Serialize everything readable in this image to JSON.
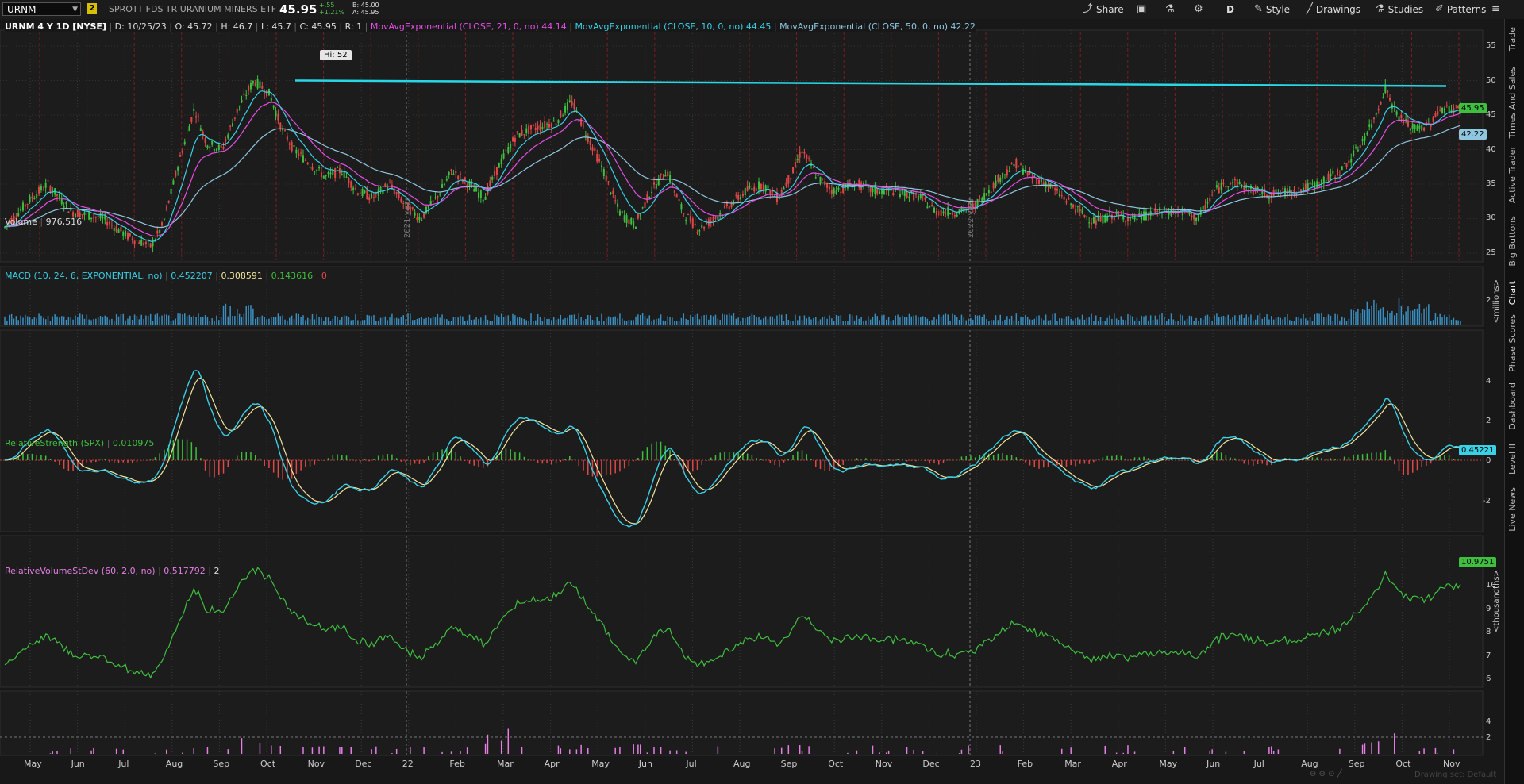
{
  "header": {
    "symbol": "URNM",
    "link_badge": "2",
    "description": "SPROTT FDS TR URANIUM MINERS ETF",
    "last": "45.95",
    "change": "+.55",
    "change_pct": "+1.21%",
    "bid": "B: 45.00",
    "ask": "A: 45.95"
  },
  "toolbar": {
    "share": "Share",
    "timeframe": "D",
    "style": "Style",
    "drawings": "Drawings",
    "studies": "Studies",
    "patterns": "Patterns"
  },
  "price_panel": {
    "title": "URNM 4 Y 1D [NYSE]",
    "ohlc": {
      "date": "D: 10/25/23",
      "open": "O: 45.72",
      "high": "H: 46.7",
      "low": "L: 45.7",
      "close": "C: 45.95",
      "r": "R: 1"
    },
    "ema21_label": "MovAvgExponential (CLOSE, 21, 0, no)",
    "ema21_value": "44.14",
    "ema10_label": "MovAvgExponential (CLOSE, 10, 0, no)",
    "ema10_value": "44.45",
    "ema50_label": "MovAvgExponential (CLOSE, 50, 0, no)",
    "ema50_value": "42.22",
    "hi_label": "Hi: 52",
    "price_tag": "45.95",
    "ema_tag": "42.22",
    "axis": [
      "55",
      "50",
      "45",
      "40",
      "35",
      "30",
      "25"
    ],
    "year_markers": [
      "2021 year",
      "2022 year"
    ],
    "colors": {
      "up": "#3fbf3f",
      "down": "#e04848",
      "ema10": "#3ad0e6",
      "ema21": "#e64ee6",
      "ema50": "#8fc6e0",
      "trendline": "#28d7e6"
    }
  },
  "volume_panel": {
    "title": "Volume",
    "value": "976,516",
    "axis": [
      "2"
    ],
    "unit": "<millions>"
  },
  "macd_panel": {
    "title": "MACD (10, 24, 6, EXPONENTIAL, no)",
    "v1": "0.452207",
    "v2": "0.308591",
    "v3": "0.143616",
    "v4": "0",
    "tag": "0.45221",
    "axis": [
      "4",
      "2",
      "0",
      "-2"
    ]
  },
  "rs_panel": {
    "title": "RelativeStrength (SPX)",
    "value": "0.010975",
    "tag": "10.9751",
    "axis": [
      "10",
      "9",
      "8",
      "7",
      "6"
    ],
    "unit": "<thousandths>"
  },
  "rvs_panel": {
    "title": "RelativeVolumeStDev (60, 2.0, no)",
    "value": "0.517792",
    "v2": "2",
    "axis": [
      "4",
      "2"
    ]
  },
  "months": [
    "May",
    "Jun",
    "Jul",
    "Aug",
    "Sep",
    "Oct",
    "Nov",
    "Dec",
    "22",
    "Feb",
    "Mar",
    "Apr",
    "May",
    "Jun",
    "Jul",
    "Aug",
    "Sep",
    "Oct",
    "Nov",
    "Dec",
    "23",
    "Feb",
    "Mar",
    "Apr",
    "May",
    "Jun",
    "Jul",
    "Aug",
    "Sep",
    "Oct",
    "Nov"
  ],
  "sidebar_tabs": [
    "Trade",
    "Times And Sales",
    "Active Trader",
    "Big Buttons",
    "Chart",
    "Phase Scores",
    "Dashboard",
    "Level II",
    "Live News"
  ],
  "footer_text": "Drawing set: Default"
}
